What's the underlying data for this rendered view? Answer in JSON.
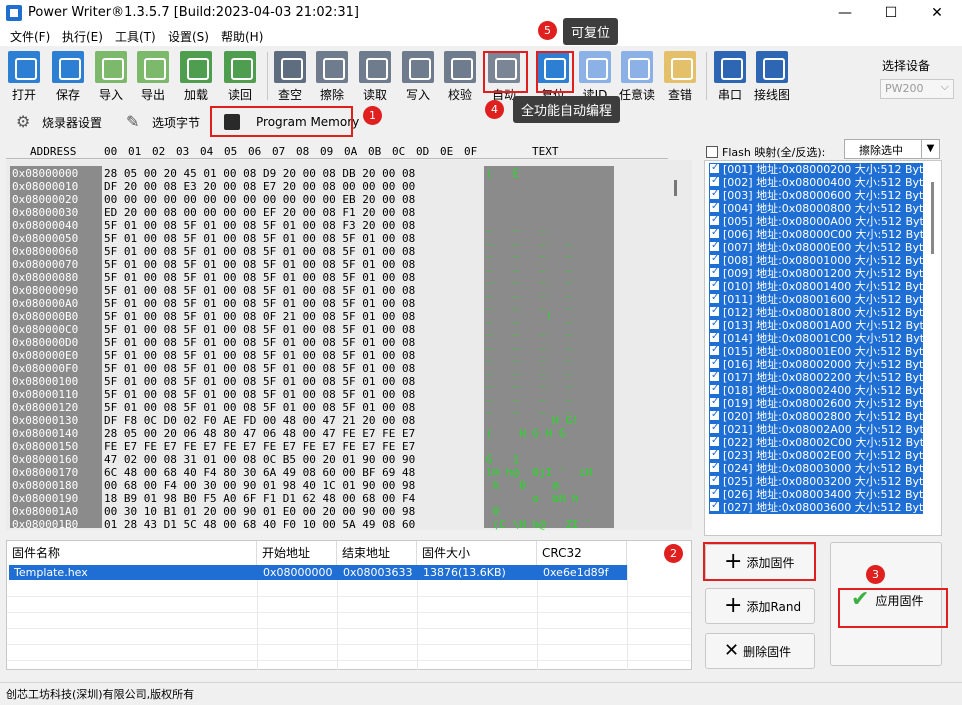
{
  "window": {
    "title": "Power Writer®1.3.5.7 [Build:2023-04-03 21:02:31]",
    "min": "—",
    "max": "☐",
    "close": "✕"
  },
  "menu": [
    "文件(F)",
    "执行(E)",
    "工具(T)",
    "设置(S)",
    "帮助(H)"
  ],
  "toolbar": [
    {
      "label": "打开",
      "icon": "open-folder-icon",
      "color": "#2d7fd3"
    },
    {
      "label": "保存",
      "icon": "save-icon",
      "color": "#2d7fd3"
    },
    {
      "label": "导入",
      "icon": "import-icon",
      "color": "#7cb96a"
    },
    {
      "label": "导出",
      "icon": "export-icon",
      "color": "#7cb96a"
    },
    {
      "label": "加载",
      "icon": "load-icon",
      "color": "#4f9d4f"
    },
    {
      "label": "读回",
      "icon": "readback-icon",
      "color": "#4f9d4f"
    },
    {
      "label": "查空",
      "icon": "blank-check-icon",
      "color": "#5f6d80"
    },
    {
      "label": "擦除",
      "icon": "erase-icon",
      "color": "#6f7c8e"
    },
    {
      "label": "读取",
      "icon": "read-icon",
      "color": "#6f7c8e"
    },
    {
      "label": "写入",
      "icon": "write-icon",
      "color": "#6f7c8e"
    },
    {
      "label": "校验",
      "icon": "verify-icon",
      "color": "#6f7c8e"
    },
    {
      "label": "自动",
      "icon": "robot-icon",
      "color": "#7a8596"
    },
    {
      "label": "复位",
      "icon": "reset-icon",
      "color": "#2d7fd3"
    },
    {
      "label": "读ID",
      "icon": "id-icon",
      "color": "#8cb1e6"
    },
    {
      "label": "任意读",
      "icon": "any-read-icon",
      "color": "#8cb1e6"
    },
    {
      "label": "查错",
      "icon": "warning-icon",
      "color": "#e5c06a"
    },
    {
      "label": "串口",
      "icon": "serial-port-icon",
      "color": "#2d66b3"
    },
    {
      "label": "接线图",
      "icon": "wiring-icon",
      "color": "#2d66b3"
    }
  ],
  "device": {
    "label": "选择设备",
    "value": "PW200"
  },
  "tabs": [
    "烧录器设置",
    "选项字节",
    "Program Memory"
  ],
  "tooltips": {
    "reset": "可复位",
    "auto": "全功能自动编程"
  },
  "markers": [
    "1",
    "2",
    "3",
    "4",
    "5"
  ],
  "hex": {
    "header": [
      "ADDRESS",
      "00",
      "01",
      "02",
      "03",
      "04",
      "05",
      "06",
      "07",
      "08",
      "09",
      "0A",
      "0B",
      "0C",
      "0D",
      "0E",
      "0F",
      "TEXT"
    ],
    "rows": [
      [
        "0x08000000",
        "28 05 00 20 45 01 00 08 D9 20 00 08 DB 20 00 08",
        "(   E          "
      ],
      [
        "0x08000010",
        "DF 20 00 08 E3 20 00 08 E7 20 00 08 00 00 00 00",
        "                "
      ],
      [
        "0x08000020",
        "00 00 00 00 00 00 00 00 00 00 00 00 EB 20 00 08",
        "                "
      ],
      [
        "0x08000030",
        "ED 20 00 08 00 00 00 00 EF 20 00 08 F1 20 00 08",
        "                "
      ],
      [
        "0x08000040",
        "5F 01 00 08 5F 01 00 08 5F 01 00 08 F3 20 00 08",
        "_   _   _       "
      ],
      [
        "0x08000050",
        "5F 01 00 08 5F 01 00 08 5F 01 00 08 5F 01 00 08",
        "_   _   _   _   "
      ],
      [
        "0x08000060",
        "5F 01 00 08 5F 01 00 08 5F 01 00 08 5F 01 00 08",
        "_   _   _   _   "
      ],
      [
        "0x08000070",
        "5F 01 00 08 5F 01 00 08 5F 01 00 08 5F 01 00 08",
        "_   _   _   _   "
      ],
      [
        "0x08000080",
        "5F 01 00 08 5F 01 00 08 5F 01 00 08 5F 01 00 08",
        "_   _   _   _   "
      ],
      [
        "0x08000090",
        "5F 01 00 08 5F 01 00 08 5F 01 00 08 5F 01 00 08",
        "_   _   _   _   "
      ],
      [
        "0x080000A0",
        "5F 01 00 08 5F 01 00 08 5F 01 00 08 5F 01 00 08",
        "_   _   _   _   "
      ],
      [
        "0x080000B0",
        "5F 01 00 08 5F 01 00 08 0F 21 00 08 5F 01 00 08",
        "_   _    !  _   "
      ],
      [
        "0x080000C0",
        "5F 01 00 08 5F 01 00 08 5F 01 00 08 5F 01 00 08",
        "_   _   _   _   "
      ],
      [
        "0x080000D0",
        "5F 01 00 08 5F 01 00 08 5F 01 00 08 5F 01 00 08",
        "_   _   _   _   "
      ],
      [
        "0x080000E0",
        "5F 01 00 08 5F 01 00 08 5F 01 00 08 5F 01 00 08",
        "_   _   _   _   "
      ],
      [
        "0x080000F0",
        "5F 01 00 08 5F 01 00 08 5F 01 00 08 5F 01 00 08",
        "_   _   _   _   "
      ],
      [
        "0x08000100",
        "5F 01 00 08 5F 01 00 08 5F 01 00 08 5F 01 00 08",
        "_   _   _   _   "
      ],
      [
        "0x08000110",
        "5F 01 00 08 5F 01 00 08 5F 01 00 08 5F 01 00 08",
        "_   _   _   _   "
      ],
      [
        "0x08000120",
        "5F 01 00 08 5F 01 00 08 5F 01 00 08 5F 01 00 08",
        "_   _   _   _   "
      ],
      [
        "0x08000130",
        "DF F8 0C D0 02 F0 AE FD 00 48 00 47 21 20 00 08",
        "          H G!  "
      ],
      [
        "0x08000140",
        "28 05 00 20 06 48 80 47 06 48 00 47 FE E7 FE E7",
        "(    H G H G    "
      ],
      [
        "0x08000150",
        "FE E7 FE E7 FE E7 FE E7 FE E7 FE E7 FE E7 FE E7",
        "                "
      ],
      [
        "0x08000160",
        "47 02 00 08 31 01 00 08 0C B5 00 20 01 90 00 90",
        "G   1           "
      ],
      [
        "0x08000170",
        "6C 48 00 68 40 F4 80 30 6A 49 08 60 00 BF 69 48",
        "lH h@  0jI `  iH"
      ],
      [
        "0x08000180",
        "00 68 00 F4 00 30 00 90 01 98 40 1C 01 90 00 98",
        " h   0    @     "
      ],
      [
        "0x08000190",
        "18 B9 01 98 B0 F5 A0 6F F1 D1 62 48 00 68 00 F4",
        "       o  bH h  "
      ],
      [
        "0x080001A0",
        "00 30 10 B1 01 20 00 90 01 E0 00 20 00 90 00 98",
        " 0              "
      ],
      [
        "0x080001B0",
        "01 28 43 D1 5C 48 00 68 40 F0 10 00 5A 49 08 60",
        " (C \\H h@   ZI `"
      ]
    ]
  },
  "flash": {
    "label": "Flash 映射(全/反选):",
    "erase_label": "擦除选中",
    "dd": "▼",
    "sectors": [
      "[001] 地址:0x08000200 大小:512 Byte",
      "[002] 地址:0x08000400 大小:512 Byte",
      "[003] 地址:0x08000600 大小:512 Byte",
      "[004] 地址:0x08000800 大小:512 Byte",
      "[005] 地址:0x08000A00 大小:512 Byte",
      "[006] 地址:0x08000C00 大小:512 Byte",
      "[007] 地址:0x08000E00 大小:512 Byte",
      "[008] 地址:0x08001000 大小:512 Byte",
      "[009] 地址:0x08001200 大小:512 Byte",
      "[010] 地址:0x08001400 大小:512 Byte",
      "[011] 地址:0x08001600 大小:512 Byte",
      "[012] 地址:0x08001800 大小:512 Byte",
      "[013] 地址:0x08001A00 大小:512 Byte",
      "[014] 地址:0x08001C00 大小:512 Byte",
      "[015] 地址:0x08001E00 大小:512 Byte",
      "[016] 地址:0x08002000 大小:512 Byte",
      "[017] 地址:0x08002200 大小:512 Byte",
      "[018] 地址:0x08002400 大小:512 Byte",
      "[019] 地址:0x08002600 大小:512 Byte",
      "[020] 地址:0x08002800 大小:512 Byte",
      "[021] 地址:0x08002A00 大小:512 Byte",
      "[022] 地址:0x08002C00 大小:512 Byte",
      "[023] 地址:0x08002E00 大小:512 Byte",
      "[024] 地址:0x08003000 大小:512 Byte",
      "[025] 地址:0x08003200 大小:512 Byte",
      "[026] 地址:0x08003400 大小:512 Byte",
      "[027] 地址:0x08003600 大小:512 Byte"
    ]
  },
  "firmware": {
    "columns": [
      "固件名称",
      "开始地址",
      "结束地址",
      "固件大小",
      "CRC32"
    ],
    "rows": [
      [
        "Template.hex",
        "0x08000000",
        "0x08003633",
        "13876(13.6KB)",
        "0xe6e1d89f"
      ]
    ]
  },
  "buttons": {
    "add_fw": "添加固件",
    "add_rand": "添加Rand",
    "delete_fw": "删除固件",
    "apply_fw": "应用固件",
    "plus": "+",
    "cross": "✕",
    "check": "✔"
  },
  "status": "创芯工坊科技(深圳)有限公司,版权所有"
}
